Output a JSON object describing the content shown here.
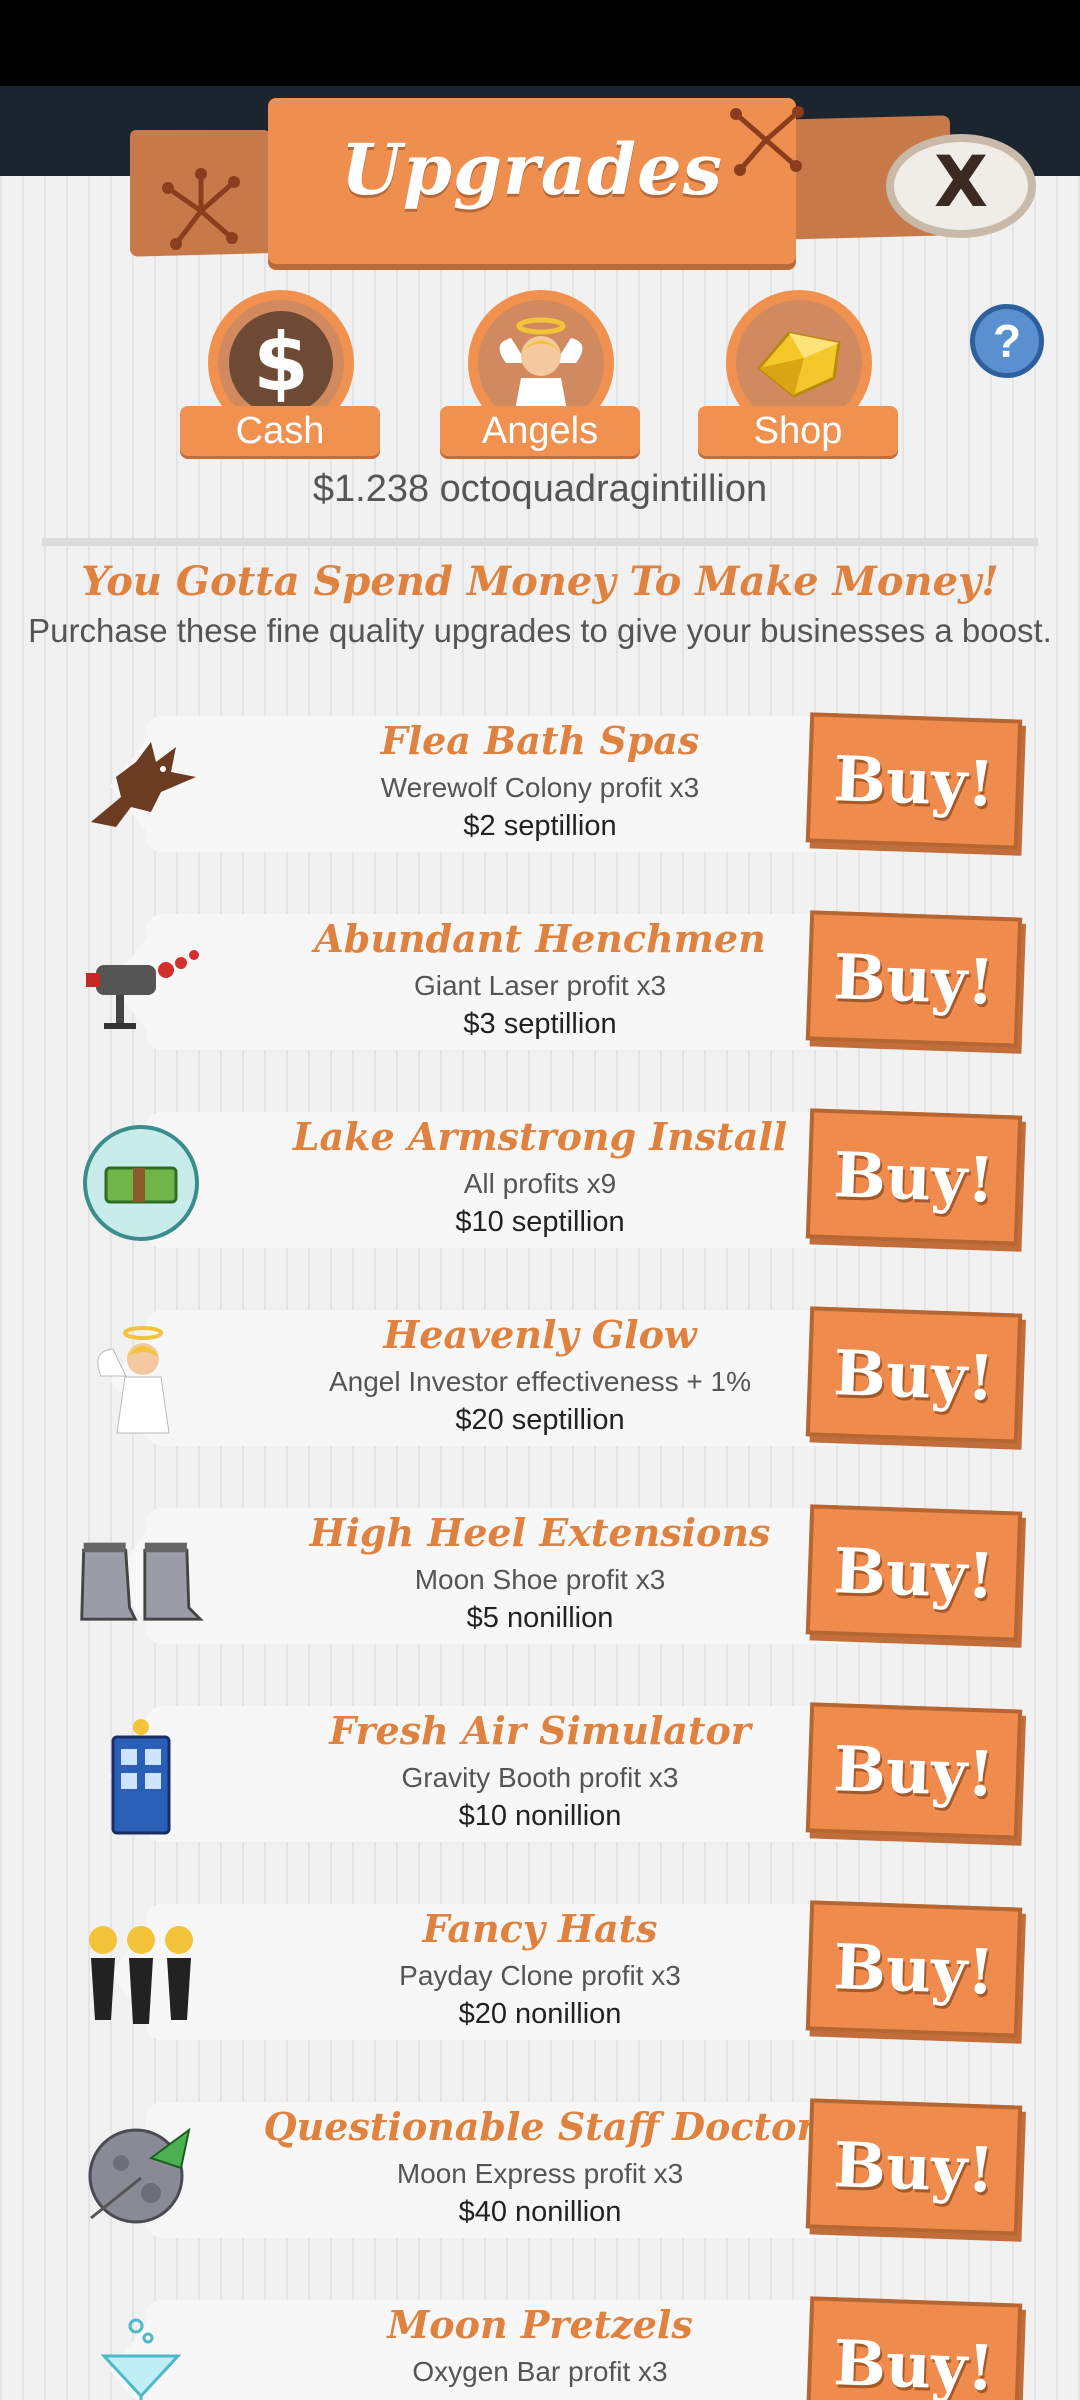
{
  "header": {
    "title": "Upgrades",
    "close_label": "X",
    "help_label": "?"
  },
  "tabs": [
    {
      "label": "Cash",
      "icon": "dollar-icon"
    },
    {
      "label": "Angels",
      "icon": "angel-icon"
    },
    {
      "label": "Shop",
      "icon": "gold-icon"
    }
  ],
  "cash_amount": "$1.238 octoquadragintillion",
  "section": {
    "heading": "You Gotta Spend Money To Make Money!",
    "subheading": "Purchase these fine quality upgrades to give your businesses a boost."
  },
  "buy_label": "Buy!",
  "upgrades": [
    {
      "name": "Flea Bath Spas",
      "desc": "Werewolf Colony profit x3",
      "cost": "$2 septillion",
      "icon": "werewolf-icon"
    },
    {
      "name": "Abundant Henchmen",
      "desc": "Giant Laser profit x3",
      "cost": "$3 septillion",
      "icon": "laser-icon"
    },
    {
      "name": "Lake Armstrong Install",
      "desc": "All profits x9",
      "cost": "$10 septillion",
      "icon": "cash-bubble-icon"
    },
    {
      "name": "Heavenly Glow",
      "desc": "Angel Investor effectiveness + 1%",
      "cost": "$20 septillion",
      "icon": "angel-icon"
    },
    {
      "name": "High Heel Extensions",
      "desc": "Moon Shoe profit x3",
      "cost": "$5 nonillion",
      "icon": "moon-boots-icon"
    },
    {
      "name": "Fresh Air Simulator",
      "desc": "Gravity Booth profit x3",
      "cost": "$10 nonillion",
      "icon": "gravity-booth-icon"
    },
    {
      "name": "Fancy Hats",
      "desc": "Payday Clone profit x3",
      "cost": "$20 nonillion",
      "icon": "clones-icon"
    },
    {
      "name": "Questionable Staff Doctor",
      "desc": "Moon Express profit x3",
      "cost": "$40 nonillion",
      "icon": "moon-rocket-icon"
    },
    {
      "name": "Moon Pretzels",
      "desc": "Oxygen Bar profit x3",
      "cost": "",
      "icon": "cocktail-icon"
    }
  ],
  "colors": {
    "accent": "#ef8f4f",
    "panel": "#f1f1f1",
    "text": "#555555"
  }
}
